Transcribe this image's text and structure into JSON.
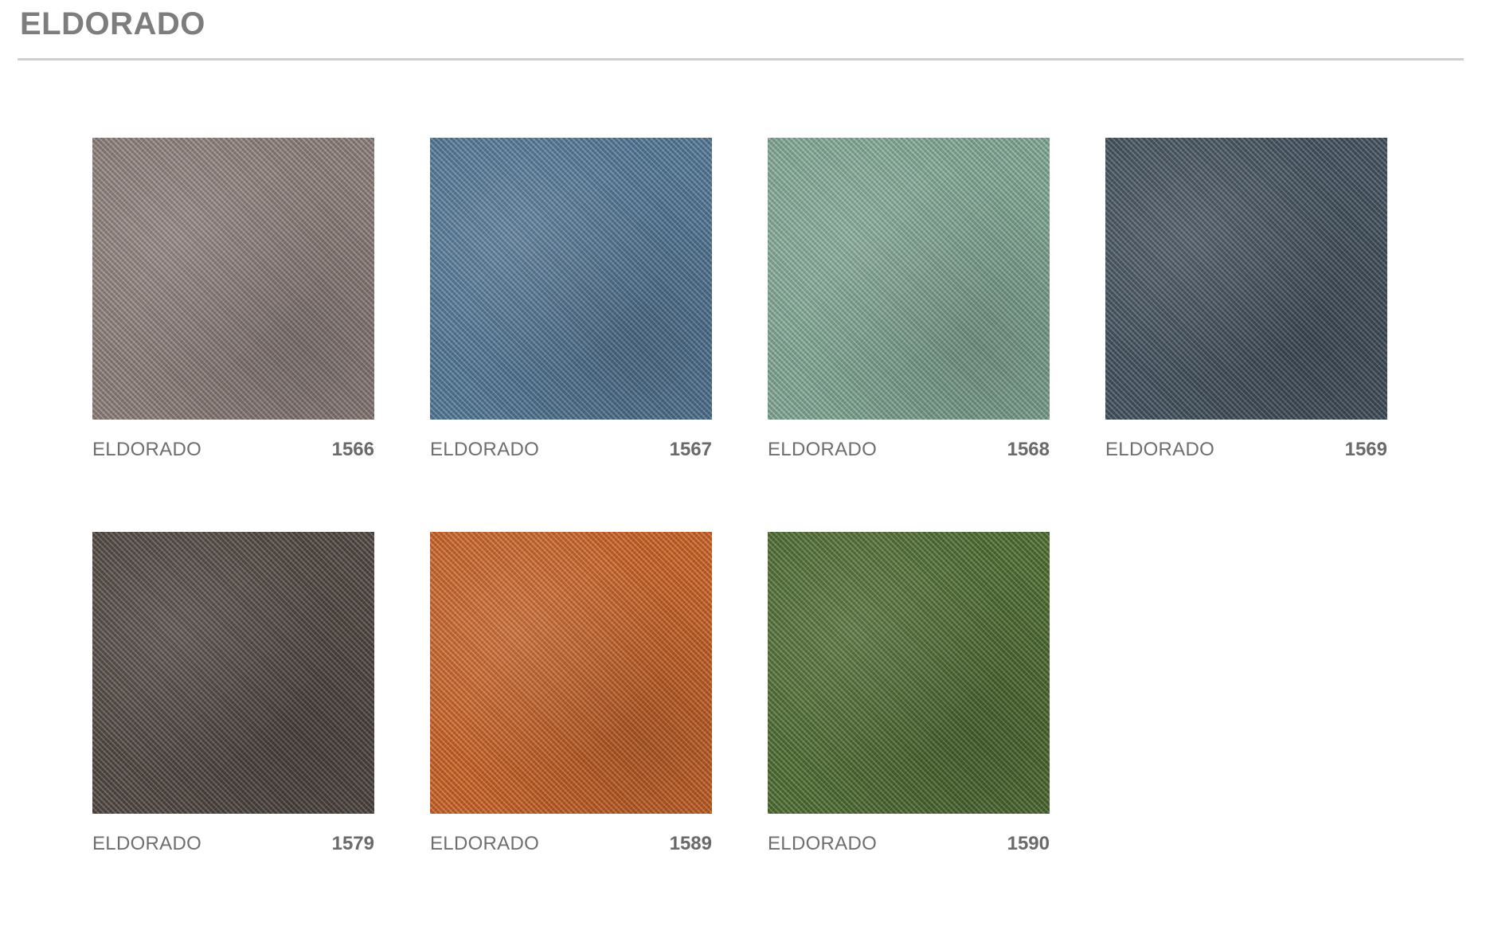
{
  "page": {
    "title": "ELDORADO"
  },
  "swatches": [
    {
      "name": "ELDORADO",
      "code": "1566",
      "color": "#8b7c78"
    },
    {
      "name": "ELDORADO",
      "code": "1567",
      "color": "#4f7596"
    },
    {
      "name": "ELDORADO",
      "code": "1568",
      "color": "#7fa894"
    },
    {
      "name": "ELDORADO",
      "code": "1569",
      "color": "#3e4d5a"
    },
    {
      "name": "ELDORADO",
      "code": "1579",
      "color": "#4c423d"
    },
    {
      "name": "ELDORADO",
      "code": "1589",
      "color": "#cc5f1f"
    },
    {
      "name": "ELDORADO",
      "code": "1590",
      "color": "#4a6a2c"
    }
  ]
}
